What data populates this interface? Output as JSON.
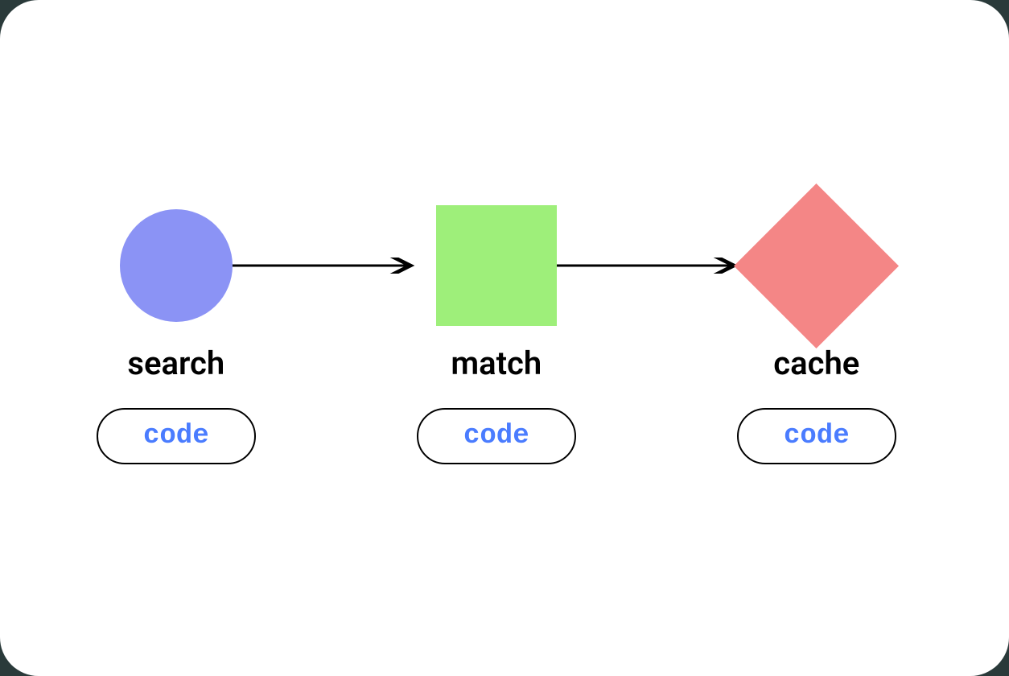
{
  "nodes": [
    {
      "label": "search",
      "button_label": "code",
      "shape": "circle",
      "color": "#8b93f5"
    },
    {
      "label": "match",
      "button_label": "code",
      "shape": "square",
      "color": "#9eef7a"
    },
    {
      "label": "cache",
      "button_label": "code",
      "shape": "diamond",
      "color": "#f48686"
    }
  ],
  "edges": [
    {
      "from": 0,
      "to": 1
    },
    {
      "from": 1,
      "to": 2
    }
  ]
}
